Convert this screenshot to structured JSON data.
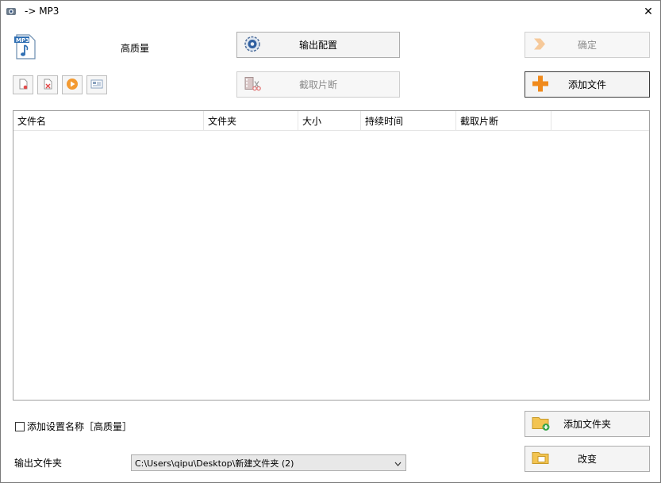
{
  "window": {
    "title": "-> MP3",
    "close_glyph": "✕"
  },
  "profile": {
    "quality_label": "高质量"
  },
  "buttons": {
    "output_config": "输出配置",
    "ok": "确定",
    "clip": "截取片断",
    "add_file": "添加文件",
    "add_folder": "添加文件夹",
    "change": "改变"
  },
  "toolbar_icons": [
    "remove-icon",
    "clear-icon",
    "play-icon",
    "info-icon"
  ],
  "table": {
    "columns": [
      "文件名",
      "文件夹",
      "大小",
      "持续时间",
      "截取片断"
    ],
    "rows": []
  },
  "settings": {
    "add_setting_name_label": "添加设置名称［高质量］",
    "add_setting_name_checked": false,
    "output_folder_label": "输出文件夹",
    "output_folder_value": "C:\\Users\\qipu\\Desktop\\新建文件夹 (2)"
  },
  "colors": {
    "accent_orange": "#f08a1c",
    "border_gray": "#adadad"
  }
}
